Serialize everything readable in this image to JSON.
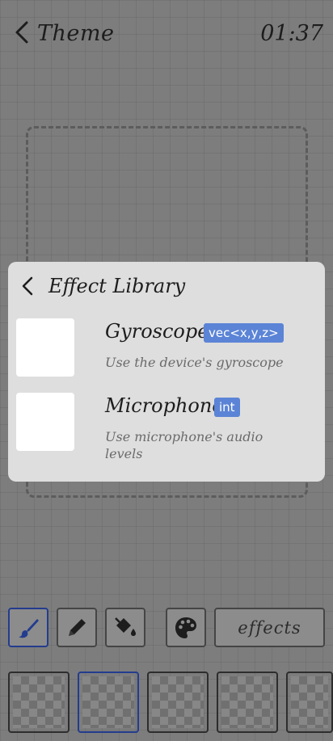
{
  "header": {
    "title": "Theme",
    "time": "01:37"
  },
  "library": {
    "title": "Effect Library",
    "effects": [
      {
        "name": "Gyroscope",
        "type": "vec<x,y,z>",
        "description": "Use the device's gyroscope"
      },
      {
        "name": "Microphone",
        "type": "int",
        "description": "Use microphone's audio levels"
      }
    ]
  },
  "toolbar": {
    "tools": [
      "brush-icon",
      "pencil-icon",
      "paint-bucket-icon",
      "palette-icon"
    ],
    "effects_label": "effects"
  },
  "colors": {
    "accent": "#5b84d6",
    "selected_border": "#233c8e"
  }
}
